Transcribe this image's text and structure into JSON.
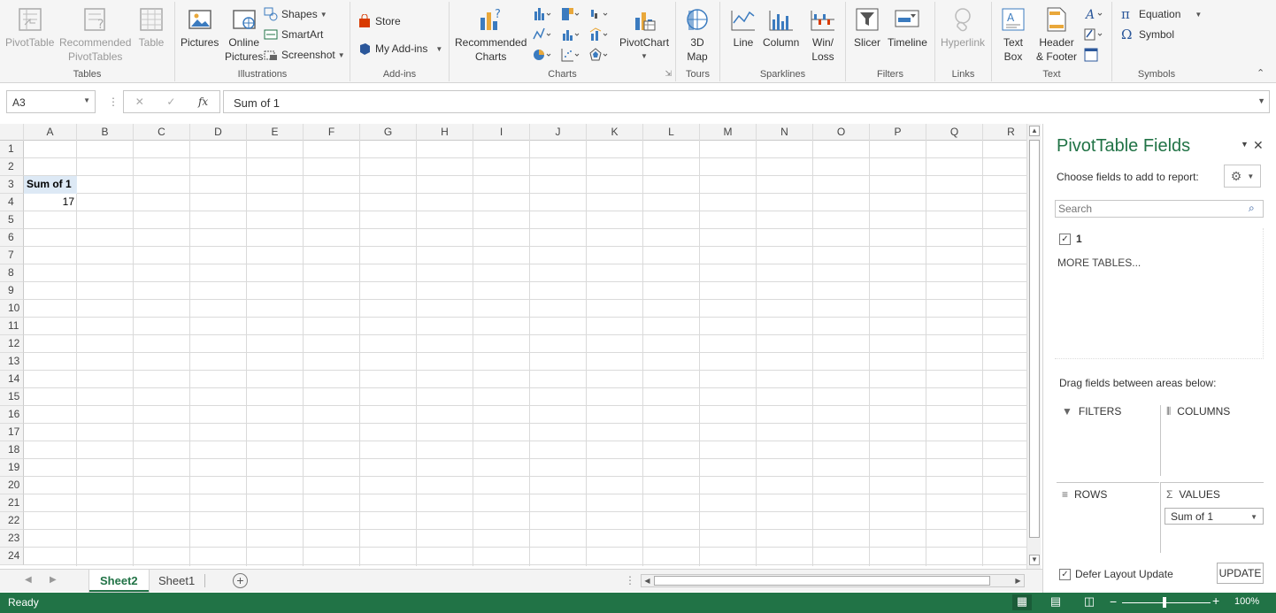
{
  "ribbon": {
    "groups": {
      "tables": "Tables",
      "illustrations": "Illustrations",
      "addins": "Add-ins",
      "charts": "Charts",
      "tours": "Tours",
      "sparklines": "Sparklines",
      "filters": "Filters",
      "links": "Links",
      "text": "Text",
      "symbols": "Symbols"
    },
    "buttons": {
      "pivottable": "PivotTable",
      "recommended_pivot_1": "Recommended",
      "recommended_pivot_2": "PivotTables",
      "table": "Table",
      "pictures": "Pictures",
      "online_pictures_1": "Online",
      "online_pictures_2": "Pictures",
      "shapes": "Shapes",
      "smartart": "SmartArt",
      "screenshot": "Screenshot",
      "store": "Store",
      "my_addins": "My Add-ins",
      "recommended_charts_1": "Recommended",
      "recommended_charts_2": "Charts",
      "pivotchart": "PivotChart",
      "map_1": "3D",
      "map_2": "Map",
      "line": "Line",
      "column": "Column",
      "winloss_1": "Win/",
      "winloss_2": "Loss",
      "slicer": "Slicer",
      "timeline": "Timeline",
      "hyperlink": "Hyperlink",
      "textbox_1": "Text",
      "textbox_2": "Box",
      "header_footer_1": "Header",
      "header_footer_2": "& Footer",
      "equation": "Equation",
      "symbol": "Symbol"
    }
  },
  "formula_bar": {
    "name_box": "A3",
    "fx": "fx",
    "content": "Sum of 1"
  },
  "grid": {
    "columns": [
      "A",
      "B",
      "C",
      "D",
      "E",
      "F",
      "G",
      "H",
      "I",
      "J",
      "K",
      "L",
      "M",
      "N",
      "O",
      "P",
      "Q",
      "R"
    ],
    "rows": [
      "1",
      "2",
      "3",
      "4",
      "5",
      "6",
      "7",
      "8",
      "9",
      "10",
      "11",
      "12",
      "13",
      "14",
      "15",
      "16",
      "17",
      "18",
      "19",
      "20",
      "21",
      "22",
      "23",
      "24"
    ],
    "cells": {
      "a3": "Sum of 1",
      "a4": "17"
    }
  },
  "sheets": {
    "tabs": [
      "Sheet2",
      "Sheet1"
    ],
    "active": "Sheet2"
  },
  "pivot_panel": {
    "title": "PivotTable Fields",
    "choose_label": "Choose fields to add to report:",
    "search_placeholder": "Search",
    "fields": [
      "1"
    ],
    "more_tables": "MORE TABLES...",
    "drag_label": "Drag fields between areas below:",
    "areas": {
      "filters": "FILTERS",
      "columns": "COLUMNS",
      "rows": "ROWS",
      "values": "VALUES"
    },
    "values_item": "Sum of 1",
    "defer_label": "Defer Layout Update",
    "update_button": "UPDATE"
  },
  "status_bar": {
    "status": "Ready",
    "zoom": "100%"
  },
  "colors": {
    "accent": "#217346",
    "selected_cell": "#dde9f5"
  }
}
